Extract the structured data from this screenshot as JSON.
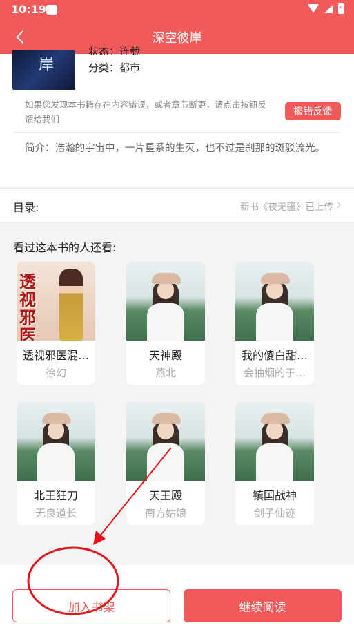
{
  "status_bar": {
    "time": "10:19"
  },
  "app_bar": {
    "title": "深空彼岸"
  },
  "book_info": {
    "cover_glyph": "岸",
    "status_partial": "状态：连载",
    "category": "分类：都市",
    "feedback_text": "如果您发现本书籍存在内容错误，或者章节断更，请点击按钮反馈给我们",
    "feedback_button": "报错反馈",
    "intro": "简介：浩瀚的宇宙中，一片星系的生灭，也不过是刹那的斑驳流光。"
  },
  "toc": {
    "label": "目录:",
    "latest": "新书《夜无疆》已上传"
  },
  "recommend": {
    "title": "看过这本书的人还看:",
    "books": [
      {
        "name": "透视邪医混…",
        "author": "徐幻",
        "cover_text": "透视邪医"
      },
      {
        "name": "天神殿",
        "author": "燕北"
      },
      {
        "name": "我的傻白甜…",
        "author": "会抽烟的于…"
      },
      {
        "name": "北王狂刀",
        "author": "无良道长"
      },
      {
        "name": "天王殿",
        "author": "南方姑娘"
      },
      {
        "name": "镇国战神",
        "author": "剑子仙迹"
      }
    ]
  },
  "bottom": {
    "add_shelf": "加入书架",
    "continue_read": "继续阅读"
  },
  "colors": {
    "accent": "#f05a5a",
    "annotation": "#e5141c"
  }
}
